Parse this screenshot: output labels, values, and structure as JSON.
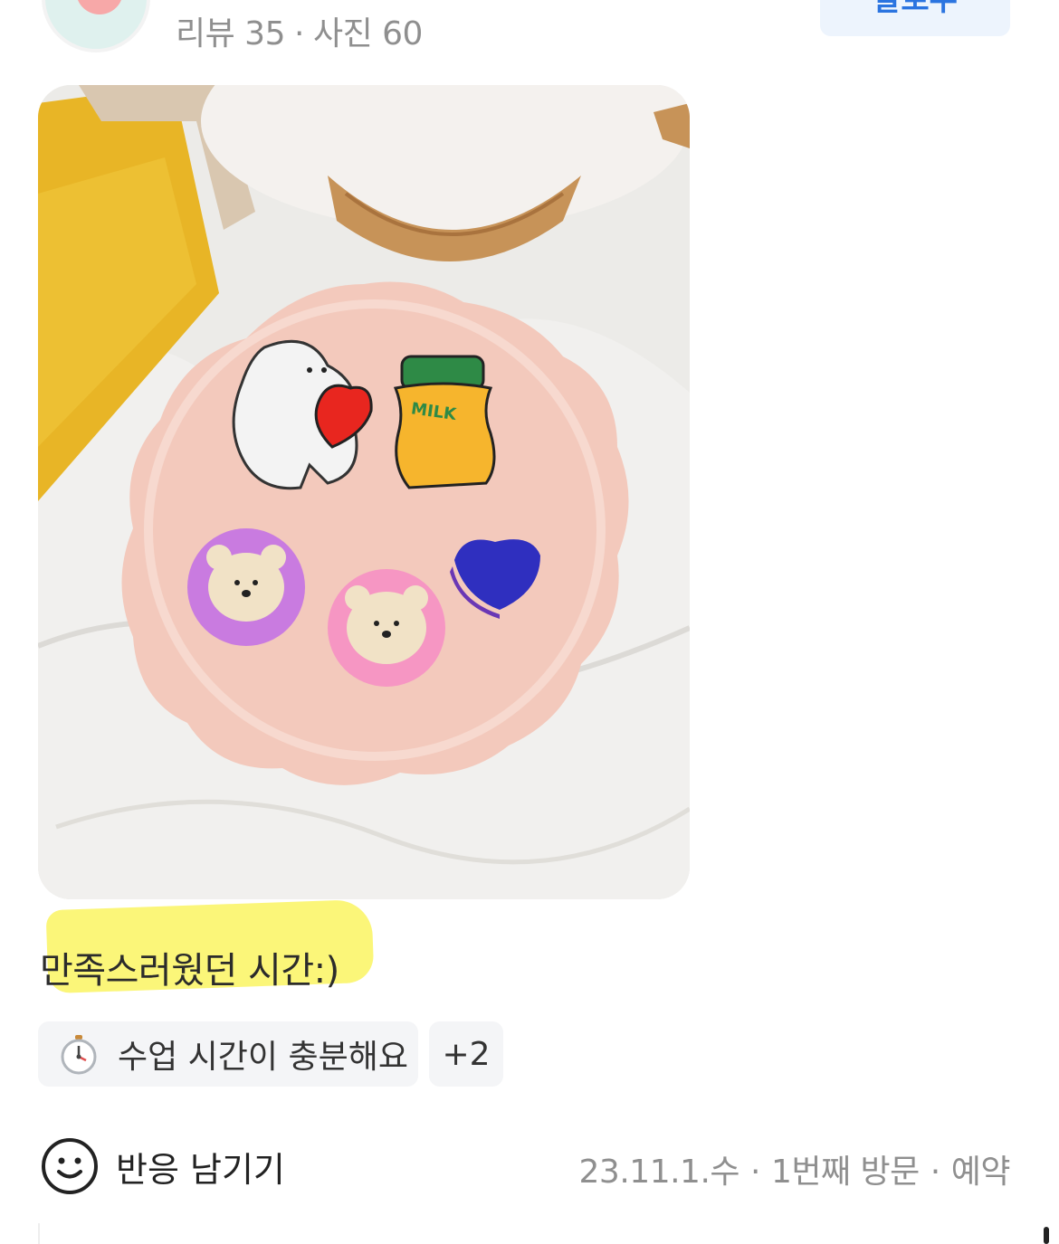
{
  "profile": {
    "reviews_label": "리뷰 35",
    "photos_label": "사진 60",
    "separator": "·",
    "follow_label": "팔로우"
  },
  "photo": {
    "milk_label": "MILK"
  },
  "review": {
    "text": "만족스러웠던 시간:)"
  },
  "tags": {
    "main_icon": "stopwatch-icon",
    "main_label": "수업 시간이 충분해요",
    "more_label": "+2"
  },
  "footer": {
    "react_icon": "smiley-icon",
    "react_label": "반응 남기기",
    "date": "23.11.1.수",
    "visit": "1번째 방문",
    "type": "예약",
    "separator": "·"
  },
  "colors": {
    "highlight": "#fbf56a",
    "follow_button_bg": "#edf4fd",
    "follow_button_text": "#2b74e0",
    "meta_text": "#8f8f8f"
  }
}
